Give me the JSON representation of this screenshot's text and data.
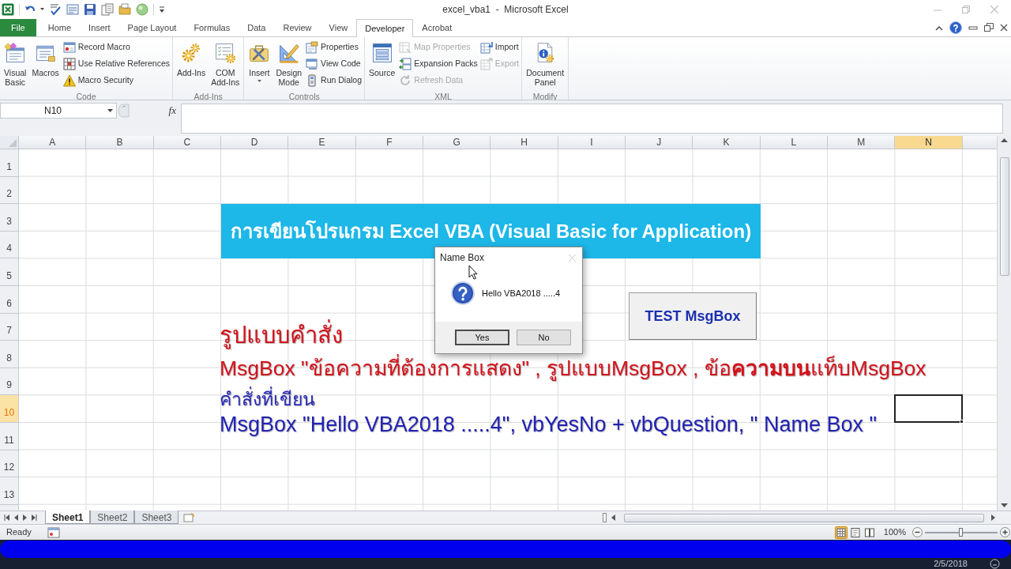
{
  "title_bar": {
    "title": "excel_vba1  -  Microsoft Excel"
  },
  "ribbon_tabs": [
    {
      "label": "File",
      "kind": "file",
      "selected": false
    },
    {
      "label": "Home",
      "kind": "tab",
      "selected": false
    },
    {
      "label": "Insert",
      "kind": "tab",
      "selected": false
    },
    {
      "label": "Page Layout",
      "kind": "tab",
      "selected": false
    },
    {
      "label": "Formulas",
      "kind": "tab",
      "selected": false
    },
    {
      "label": "Data",
      "kind": "tab",
      "selected": false
    },
    {
      "label": "Review",
      "kind": "tab",
      "selected": false
    },
    {
      "label": "View",
      "kind": "tab",
      "selected": false
    },
    {
      "label": "Developer",
      "kind": "tab",
      "selected": true
    },
    {
      "label": "Acrobat",
      "kind": "tab",
      "selected": false
    }
  ],
  "ribbon_groups": [
    {
      "label": "Code",
      "commands": [
        {
          "label": "Visual Basic",
          "kind": "large",
          "disabled": false
        },
        {
          "label": "Macros",
          "kind": "large",
          "disabled": false
        },
        {
          "label": "Record Macro",
          "kind": "small",
          "disabled": false
        },
        {
          "label": "Use Relative References",
          "kind": "small",
          "disabled": false
        },
        {
          "label": "Macro Security",
          "kind": "small",
          "disabled": false
        }
      ]
    },
    {
      "label": "Add-Ins",
      "commands": [
        {
          "label": "Add-Ins",
          "kind": "large",
          "disabled": false
        },
        {
          "label": "COM Add-Ins",
          "kind": "large",
          "disabled": false
        }
      ]
    },
    {
      "label": "Controls",
      "commands": [
        {
          "label": "Insert",
          "kind": "large_menu",
          "disabled": false
        },
        {
          "label": "Design Mode",
          "kind": "large",
          "disabled": false
        },
        {
          "label": "Properties",
          "kind": "small",
          "disabled": false
        },
        {
          "label": "View Code",
          "kind": "small",
          "disabled": false
        },
        {
          "label": "Run Dialog",
          "kind": "small",
          "disabled": false
        }
      ]
    },
    {
      "label": "XML",
      "commands": [
        {
          "label": "Source",
          "kind": "large",
          "disabled": false
        },
        {
          "label": "Map Properties",
          "kind": "small",
          "disabled": true
        },
        {
          "label": "Expansion Packs",
          "kind": "small",
          "disabled": false
        },
        {
          "label": "Refresh Data",
          "kind": "small",
          "disabled": true
        },
        {
          "label": "Import",
          "kind": "small",
          "disabled": false
        },
        {
          "label": "Export",
          "kind": "small",
          "disabled": true
        }
      ]
    },
    {
      "label": "Modify",
      "commands": [
        {
          "label": "Document Panel",
          "kind": "large",
          "disabled": false
        }
      ]
    }
  ],
  "formula_bar": {
    "name_box": "N10",
    "function_button": "fx"
  },
  "sheet": {
    "columns": [
      {
        "label": "A",
        "selected": false
      },
      {
        "label": "B",
        "selected": false
      },
      {
        "label": "C",
        "selected": false
      },
      {
        "label": "D",
        "selected": false
      },
      {
        "label": "E",
        "selected": false
      },
      {
        "label": "F",
        "selected": false
      },
      {
        "label": "G",
        "selected": false
      },
      {
        "label": "H",
        "selected": false
      },
      {
        "label": "I",
        "selected": false
      },
      {
        "label": "J",
        "selected": false
      },
      {
        "label": "K",
        "selected": false
      },
      {
        "label": "L",
        "selected": false
      },
      {
        "label": "M",
        "selected": false
      },
      {
        "label": "N",
        "selected": true
      }
    ],
    "rows": [
      {
        "label": "1",
        "selected": false
      },
      {
        "label": "2",
        "selected": false
      },
      {
        "label": "3",
        "selected": false
      },
      {
        "label": "4",
        "selected": false
      },
      {
        "label": "5",
        "selected": false
      },
      {
        "label": "6",
        "selected": false
      },
      {
        "label": "7",
        "selected": false
      },
      {
        "label": "8",
        "selected": false
      },
      {
        "label": "9",
        "selected": false
      },
      {
        "label": "10",
        "selected": true
      },
      {
        "label": "11",
        "selected": false
      },
      {
        "label": "12",
        "selected": false
      },
      {
        "label": "13",
        "selected": false
      }
    ],
    "banner": "การเขียนโปรแกรม Excel VBA (Visual Basic for Application)",
    "test_button": "TEST MsgBox",
    "notes": [
      {
        "kind": "heading",
        "text": "รูปแบบคำสั่ง"
      },
      {
        "kind": "syntax",
        "text": "MsgBox \"ข้อความที่ต้องการแสดง\" , รูปแบบMsgBox , ข้อ**ความบน**แท็บMsgBox"
      },
      {
        "kind": "label",
        "text": "คำสั่งที่เขียน"
      },
      {
        "kind": "code",
        "text": "MsgBox \"Hello VBA2018 .....4\", vbYesNo + vbQuestion, \" Name Box \""
      }
    ]
  },
  "dialog": {
    "title": "Name Box",
    "message": "Hello VBA2018 .....4",
    "buttons": [
      {
        "label": "Yes",
        "selected": true
      },
      {
        "label": "No",
        "selected": false
      }
    ]
  },
  "sheet_tabs": [
    {
      "label": "Sheet1",
      "selected": true
    },
    {
      "label": "Sheet2",
      "selected": false
    },
    {
      "label": "Sheet3",
      "selected": false
    }
  ],
  "status_bar": {
    "status": "Ready",
    "views": [
      {
        "selected": true
      },
      {
        "selected": false
      },
      {
        "selected": false
      }
    ],
    "zoom": "100%",
    "zoom_slider": {
      "level": 0.5
    }
  },
  "taskbar": {
    "date": "2/5/2018"
  }
}
